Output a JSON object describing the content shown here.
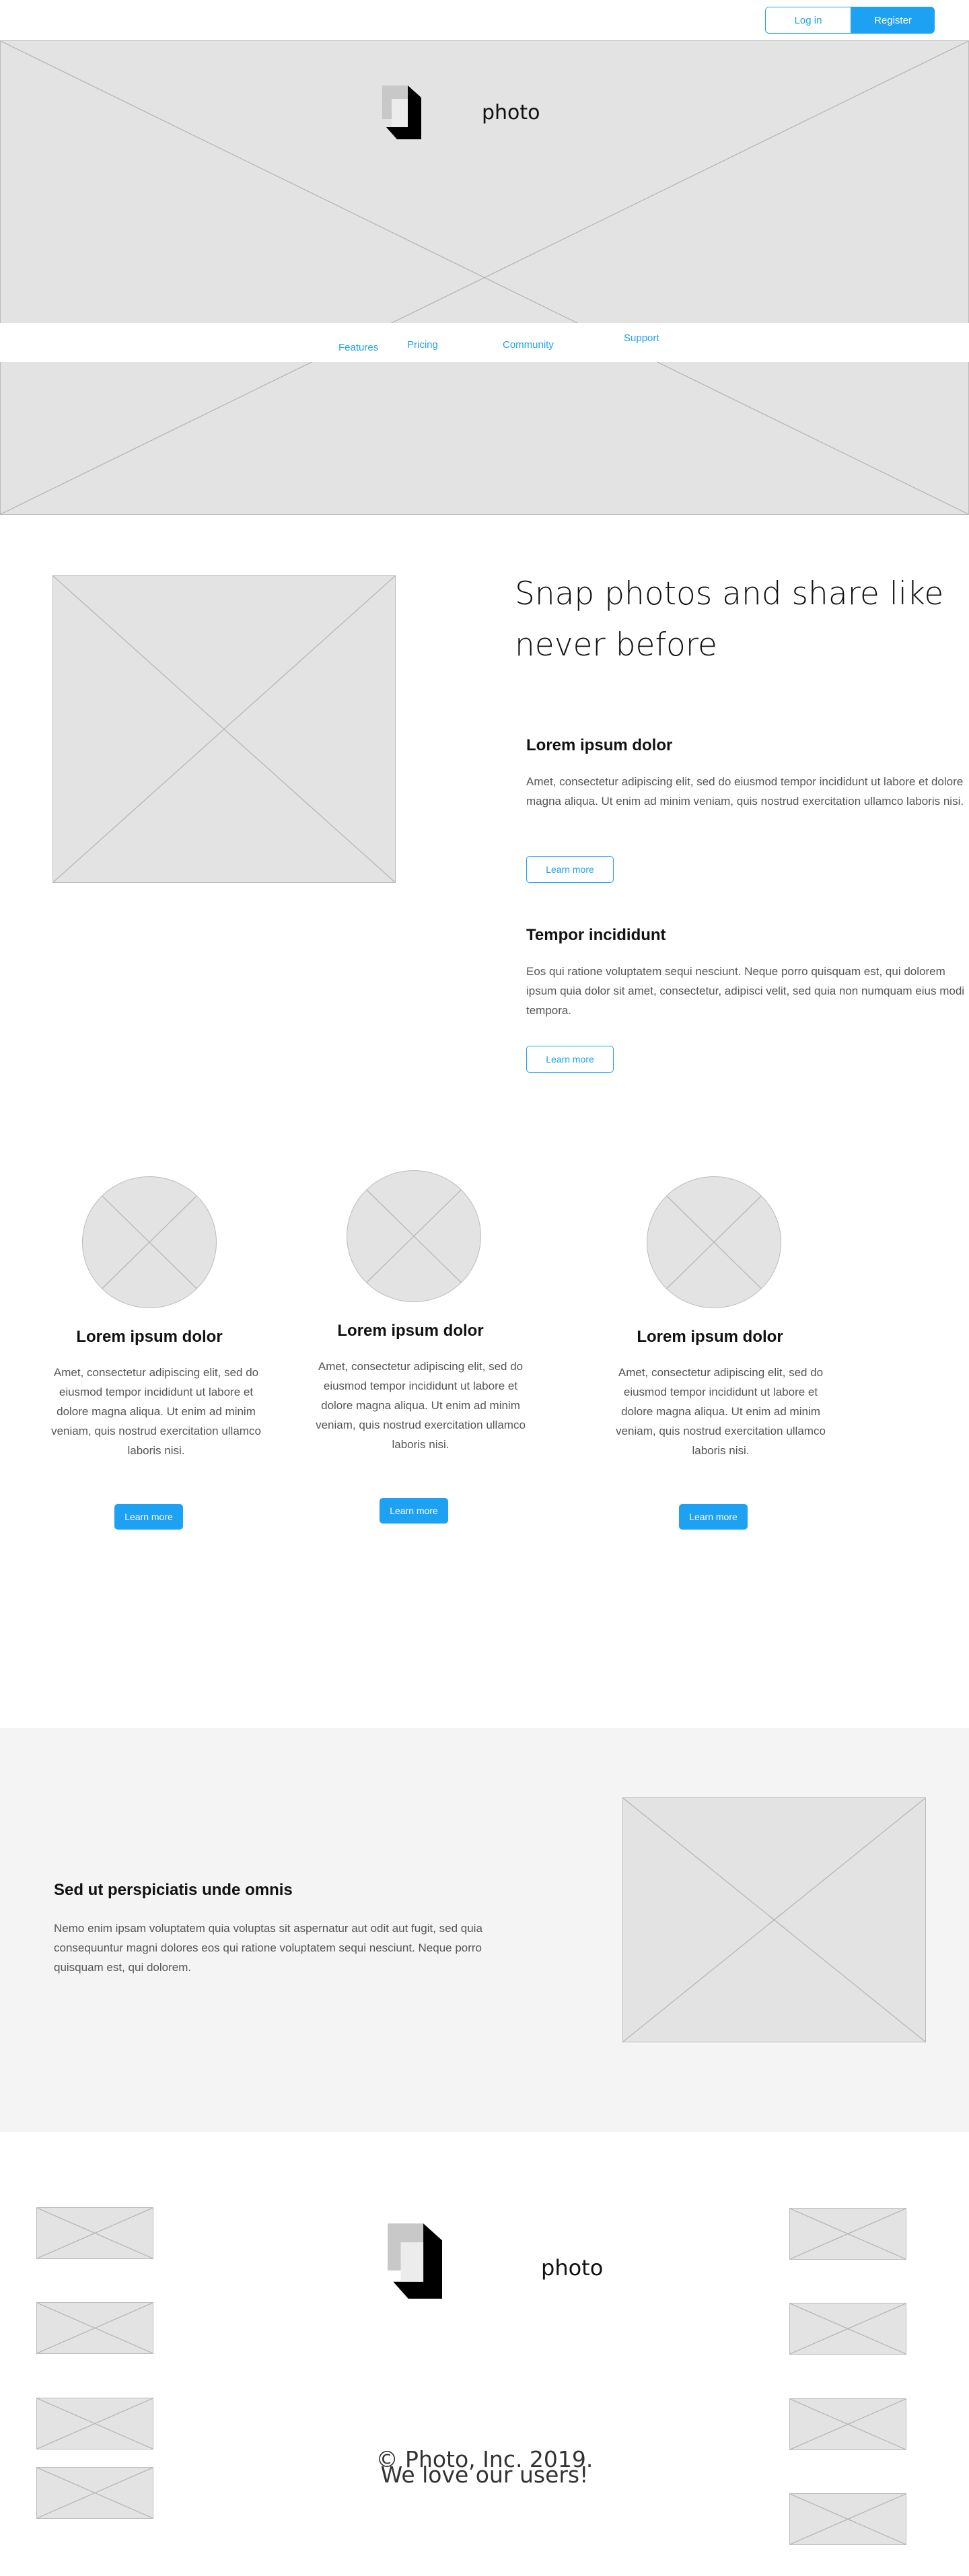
{
  "header": {
    "login_label": "Log in",
    "register_label": "Register"
  },
  "brand": {
    "name": "photo",
    "logo_icon": "photo-logo-icon"
  },
  "nav": {
    "items": [
      {
        "label": "Features"
      },
      {
        "label": "Pricing"
      },
      {
        "label": "Community"
      },
      {
        "label": "Support"
      }
    ]
  },
  "intro": {
    "headline": "Snap photos and share like never before",
    "features": [
      {
        "title": "Lorem ipsum dolor",
        "body": "Amet, consectetur adipiscing elit, sed do eiusmod tempor incididunt ut labore et dolore magna aliqua. Ut enim ad minim veniam, quis nostrud exercitation ullamco laboris nisi.",
        "button": "Learn more"
      },
      {
        "title": "Tempor incididunt",
        "body": "Eos qui ratione voluptatem sequi nesciunt. Neque porro quisquam est, qui dolorem ipsum quia dolor sit amet, consectetur, adipisci velit, sed quia non numquam eius modi tempora.",
        "button": "Learn more"
      }
    ]
  },
  "cards": [
    {
      "title": "Lorem ipsum dolor",
      "body": "Amet, consectetur adipiscing elit, sed do eiusmod tempor incididunt ut labore et dolore magna aliqua. Ut enim ad minim veniam, quis nostrud exercitation ullamco laboris nisi.",
      "button": "Learn more"
    },
    {
      "title": "Lorem ipsum dolor",
      "body": "Amet, consectetur adipiscing elit, sed do eiusmod tempor incididunt ut labore et dolore magna aliqua. Ut enim ad minim veniam, quis nostrud exercitation ullamco laboris nisi.",
      "button": "Learn more"
    },
    {
      "title": "Lorem ipsum dolor",
      "body": "Amet, consectetur adipiscing elit, sed do eiusmod tempor incididunt ut labore et dolore magna aliqua. Ut enim ad minim veniam, quis nostrud exercitation ullamco laboris nisi.",
      "button": "Learn more"
    }
  ],
  "highlight": {
    "title": "Sed ut perspiciatis unde omnis",
    "body": "Nemo enim ipsam voluptatem quia voluptas sit aspernatur aut odit aut fugit, sed quia consequuntur magni dolores eos qui ratione voluptatem sequi nesciunt. Neque porro quisquam est, qui dolorem."
  },
  "footer": {
    "copyright": "© Photo, Inc. 2019.",
    "tagline": "We love our users!"
  },
  "colors": {
    "accent": "#1da1f2",
    "placeholder": "#e3e3e3",
    "band": "#f4f4f4"
  }
}
